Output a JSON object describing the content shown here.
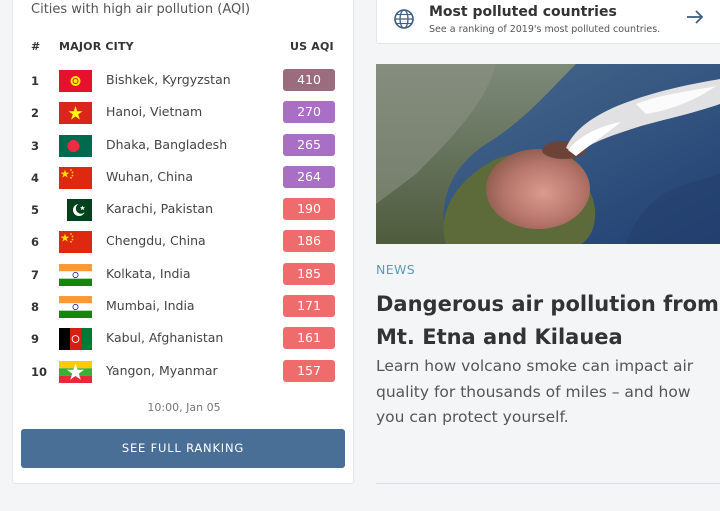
{
  "ranking": {
    "title": "Cities with high air pollution (AQI)",
    "col_rank": "#",
    "col_city": "MAJOR CITY",
    "col_aqi": "US AQI",
    "rows": [
      {
        "rank": "1",
        "city": "Bishkek, Kyrgyzstan",
        "aqi": "410",
        "flag": "kyrgyzstan-flag-icon"
      },
      {
        "rank": "2",
        "city": "Hanoi, Vietnam",
        "aqi": "270",
        "flag": "vietnam-flag-icon"
      },
      {
        "rank": "3",
        "city": "Dhaka, Bangladesh",
        "aqi": "265",
        "flag": "bangladesh-flag-icon"
      },
      {
        "rank": "4",
        "city": "Wuhan, China",
        "aqi": "264",
        "flag": "china-flag-icon"
      },
      {
        "rank": "5",
        "city": "Karachi, Pakistan",
        "aqi": "190",
        "flag": "pakistan-flag-icon"
      },
      {
        "rank": "6",
        "city": "Chengdu, China",
        "aqi": "186",
        "flag": "china-flag-icon"
      },
      {
        "rank": "7",
        "city": "Kolkata, India",
        "aqi": "185",
        "flag": "india-flag-icon"
      },
      {
        "rank": "8",
        "city": "Mumbai, India",
        "aqi": "171",
        "flag": "india-flag-icon"
      },
      {
        "rank": "9",
        "city": "Kabul, Afghanistan",
        "aqi": "161",
        "flag": "afghanistan-flag-icon"
      },
      {
        "rank": "10",
        "city": "Yangon, Myanmar",
        "aqi": "157",
        "flag": "myanmar-flag-icon"
      }
    ],
    "timestamp": "10:00, Jan 05",
    "button_label": "SEE FULL RANKING"
  },
  "countries_card": {
    "title": "Most polluted countries",
    "subtitle": "See a ranking of 2019's most polluted countries."
  },
  "article": {
    "tag": "NEWS",
    "headline": "Dangerous air pollution from Mt. Etna and Kilauea",
    "description": "Learn how volcano smoke can impact air quality for thousands of miles – and how you can protect yourself."
  },
  "colors": {
    "hazardous": "#9b6b7e",
    "very_unhealthy": "#a86fc4",
    "unhealthy": "#f06c6c",
    "button": "#4a6f96",
    "tag": "#5a9bb9"
  }
}
